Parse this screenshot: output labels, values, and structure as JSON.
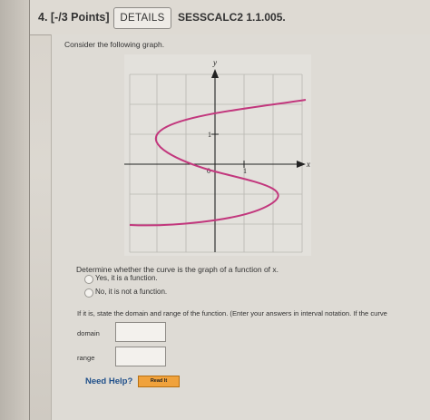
{
  "header": {
    "question_number": "4. [-/3 Points]",
    "details_label": "DETAILS",
    "source_code": "SESSCALC2 1.1.005."
  },
  "prompt": "Consider the following graph.",
  "graph": {
    "y_label": "y",
    "x_label": "x",
    "origin_label": "0",
    "tick_x_label": "1",
    "tick_y_label": "1",
    "grid": true,
    "curve_color": "#c2377d"
  },
  "question": {
    "determine": "Determine whether the curve is the graph of a function of x.",
    "options": [
      "Yes, it is a function.",
      "No, it is not a function."
    ],
    "instruction": "If it is, state the domain and range of the function. (Enter your answers in interval notation. If the curve",
    "domain_label": "domain",
    "range_label": "range",
    "domain_value": "",
    "range_value": ""
  },
  "help": {
    "need_help": "Need Help?",
    "read_it": "Read It"
  }
}
